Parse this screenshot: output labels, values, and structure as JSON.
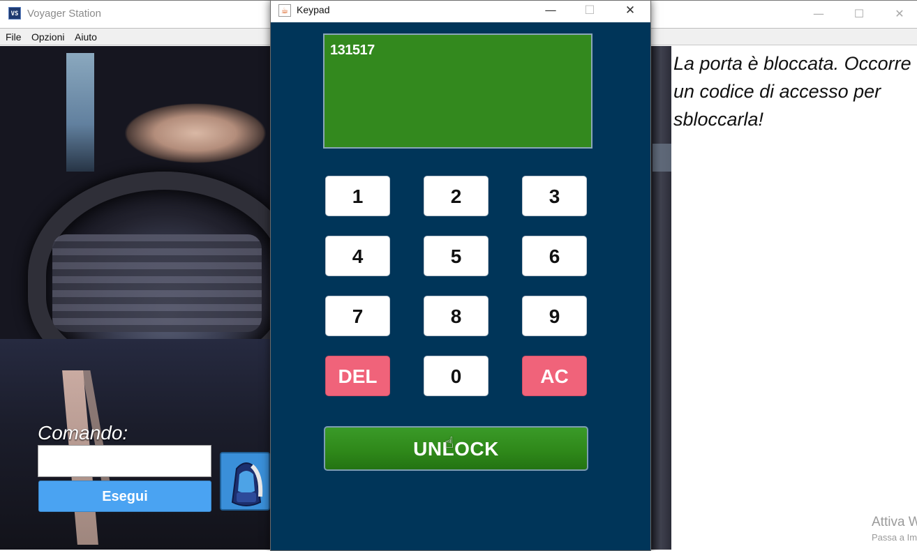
{
  "main_window": {
    "title": "Voyager Station",
    "icon": "app-icon",
    "controls": {
      "minimize": "—",
      "maximize": "☐",
      "close": "✕"
    },
    "menu": [
      "File",
      "Opzioni",
      "Aiuto"
    ]
  },
  "scene": {
    "command_label": "Comando:",
    "command_value": "",
    "run_label": "Esegui",
    "backpack_icon": "backpack-icon"
  },
  "description": {
    "text": "La porta è bloccata. Occorre un codice di accesso per sbloccarla!"
  },
  "watermark": {
    "line1": "Attiva Windows",
    "line2": "Passa a Impostazioni per attivare Windows."
  },
  "keypad_window": {
    "title": "Keypad",
    "icon": "java-icon",
    "controls": {
      "minimize": "—",
      "maximize": "☐",
      "close": "✕"
    },
    "display_value": "131517",
    "keys": [
      "1",
      "2",
      "3",
      "4",
      "5",
      "6",
      "7",
      "8",
      "9",
      "DEL",
      "0",
      "AC"
    ],
    "unlock_label": "UNLOCK",
    "colors": {
      "background": "#003559",
      "display": "#33891e",
      "danger": "#f0637a",
      "unlock": "#2e8719"
    }
  }
}
